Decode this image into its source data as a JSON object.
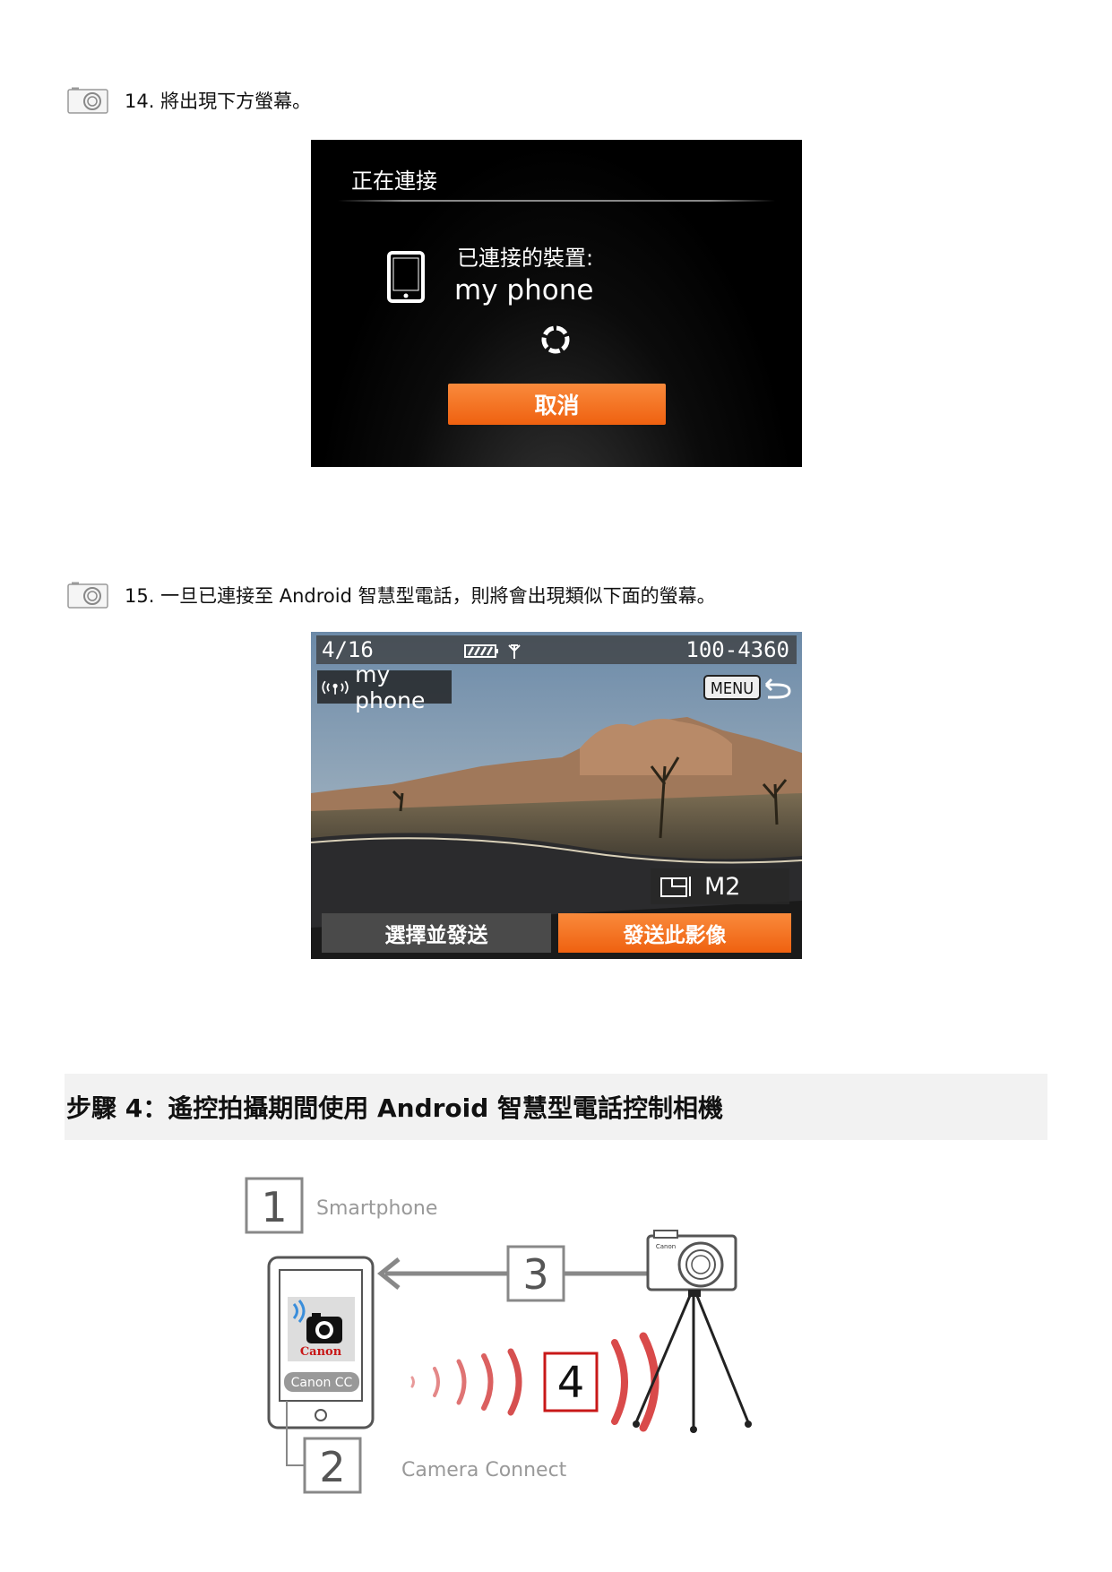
{
  "step14": {
    "text": "14. 將出現下方螢幕。"
  },
  "screen1": {
    "title": "正在連接",
    "connected_label": "已連接的裝置:",
    "device_name": "my phone",
    "cancel_label": "取消"
  },
  "step15": {
    "text": "15. 一旦已連接至 Android 智慧型電話，則將會出現類似下面的螢幕。"
  },
  "screen2": {
    "image_counter": "4/16",
    "file_number": "100-4360",
    "device_name": "my phone",
    "menu_label": "MENU",
    "size_label": "M2",
    "select_send_label": "選擇並發送",
    "send_image_label": "發送此影像",
    "accent_color": "#ef6110"
  },
  "section": {
    "title": "步驟 4：遙控拍攝期間使用 Android 智慧型電話控制相機"
  },
  "diagram": {
    "labels": [
      {
        "num": "1",
        "text": "Smartphone"
      },
      {
        "num": "2",
        "text": "Camera Connect"
      },
      {
        "num": "3",
        "text": ""
      },
      {
        "num": "4",
        "text": ""
      }
    ],
    "app_brand": "Canon",
    "app_name": "Canon CC",
    "camera_brand": "Canon"
  }
}
